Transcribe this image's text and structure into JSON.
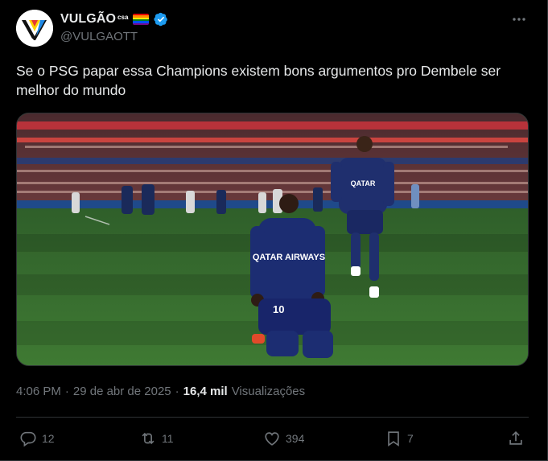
{
  "author": {
    "display_name": "VULGÃO",
    "affiliate_badge": "csa",
    "handle": "@VULGAOTT",
    "verified": true,
    "avatar_icon": "vulgao-logo"
  },
  "tweet": {
    "text": "Se o PSG papar essa Champions existem bons argumentos pro Dembele ser melhor do mundo",
    "media": {
      "shirt_sponsor": "QATAR AIRWAYS",
      "player_number": "10"
    }
  },
  "meta": {
    "time": "4:06 PM",
    "separator": "·",
    "date": "29 de abr de 2025",
    "views_count": "16,4 mil",
    "views_label": "Visualizações"
  },
  "actions": {
    "replies": "12",
    "retweets": "11",
    "likes": "394",
    "bookmarks": "7"
  },
  "colors": {
    "background": "#000000",
    "text": "#e7e9ea",
    "secondary": "#71767b",
    "verified": "#1d9bf0",
    "border": "#2f3336"
  }
}
